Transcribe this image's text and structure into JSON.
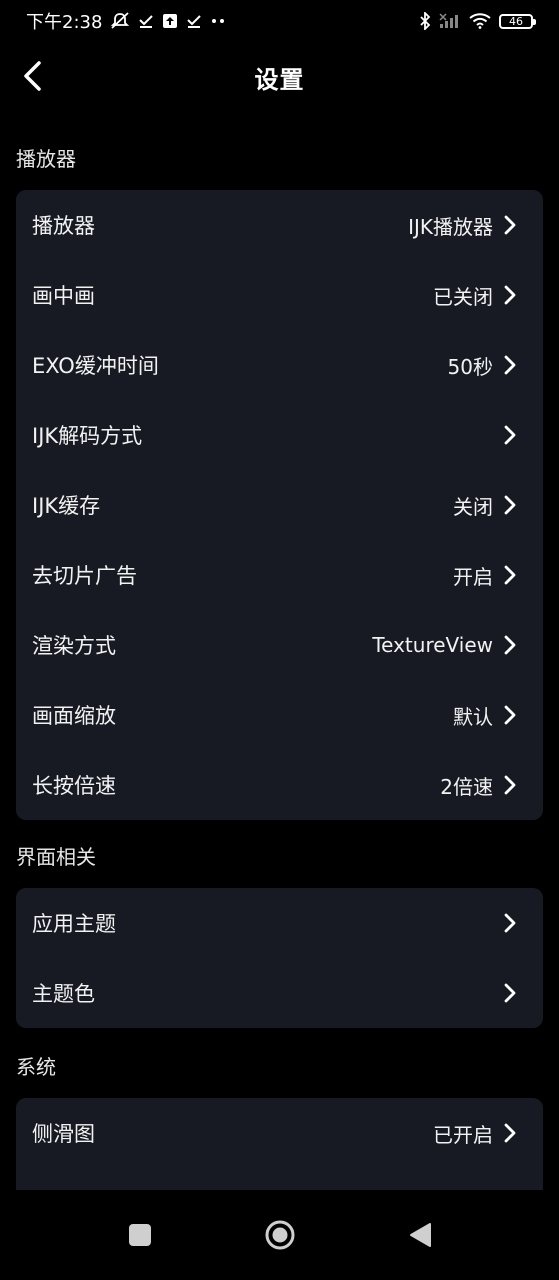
{
  "status_bar": {
    "time": "下午2:38",
    "battery": "46",
    "icons": [
      "mute-bell-icon",
      "download-done-icon",
      "upload-icon",
      "download-done-icon",
      "more-dots-icon",
      "bluetooth-icon",
      "signal-icon",
      "wifi-icon",
      "battery-icon"
    ]
  },
  "header": {
    "title": "设置"
  },
  "sections": {
    "player": {
      "title": "播放器",
      "items": [
        {
          "label": "播放器",
          "value": "IJK播放器"
        },
        {
          "label": "画中画",
          "value": "已关闭"
        },
        {
          "label": "EXO缓冲时间",
          "value": "50秒"
        },
        {
          "label": "IJK解码方式",
          "value": ""
        },
        {
          "label": "IJK缓存",
          "value": "关闭"
        },
        {
          "label": "去切片广告",
          "value": "开启"
        },
        {
          "label": "渲染方式",
          "value": "TextureView"
        },
        {
          "label": "画面缩放",
          "value": "默认"
        },
        {
          "label": "长按倍速",
          "value": "2倍速"
        }
      ]
    },
    "ui": {
      "title": "界面相关",
      "items": [
        {
          "label": "应用主题",
          "value": ""
        },
        {
          "label": "主题色",
          "value": ""
        }
      ]
    },
    "system": {
      "title": "系统",
      "items": [
        {
          "label": "侧滑图",
          "value": "已开启"
        }
      ]
    }
  },
  "colors": {
    "background": "#000000",
    "card": "#171a22",
    "text": "#ffffff"
  }
}
